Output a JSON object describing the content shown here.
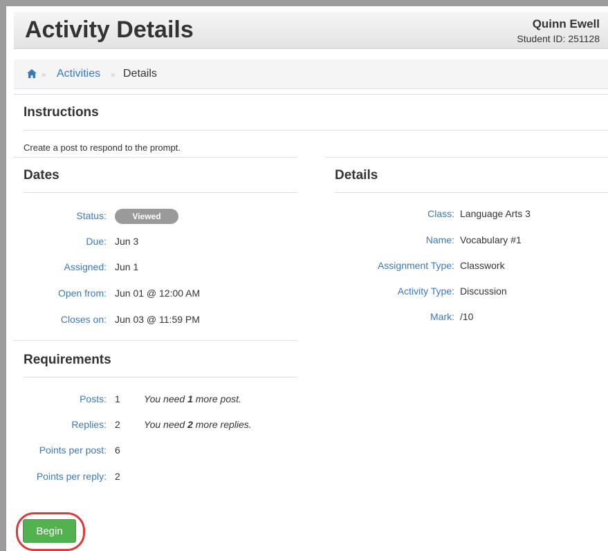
{
  "header": {
    "title": "Activity Details",
    "user_name": "Quinn Ewell",
    "student_id": "Student ID: 251128"
  },
  "breadcrumb": {
    "home_icon": "home-icon",
    "separator": "»",
    "items": [
      "Activities",
      "Details"
    ]
  },
  "instructions": {
    "title": "Instructions",
    "text": "Create a post to respond to the prompt."
  },
  "dates": {
    "title": "Dates",
    "status_label": "Status:",
    "status_value": "Viewed",
    "due_label": "Due:",
    "due_value": "Jun 3",
    "assigned_label": "Assigned:",
    "assigned_value": "Jun 1",
    "open_label": "Open from:",
    "open_value": "Jun 01 @ 12:00 AM",
    "close_label": "Closes on:",
    "close_value": "Jun 03 @ 11:59 PM"
  },
  "details": {
    "title": "Details",
    "class_label": "Class:",
    "class_value": "Language Arts 3",
    "name_label": "Name:",
    "name_value": "Vocabulary #1",
    "assignment_type_label": "Assignment Type:",
    "assignment_type_value": "Classwork",
    "activity_type_label": "Activity Type:",
    "activity_type_value": "Discussion",
    "mark_label": "Mark:",
    "mark_value": "/10"
  },
  "requirements": {
    "title": "Requirements",
    "posts_label": "Posts:",
    "posts_value": "1",
    "posts_note_pre": "You need ",
    "posts_note_num": "1",
    "posts_note_post": " more post.",
    "replies_label": "Replies:",
    "replies_value": "2",
    "replies_note_pre": "You need ",
    "replies_note_num": "2",
    "replies_note_post": " more replies.",
    "ppp_label": "Points per post:",
    "ppp_value": "6",
    "ppr_label": "Points per reply:",
    "ppr_value": "2"
  },
  "actions": {
    "begin_label": "Begin"
  },
  "colors": {
    "link": "#3a79b8",
    "begin_button": "#52b24d",
    "highlight_ring": "#e0373a",
    "status_badge": "#9a9a9a"
  }
}
